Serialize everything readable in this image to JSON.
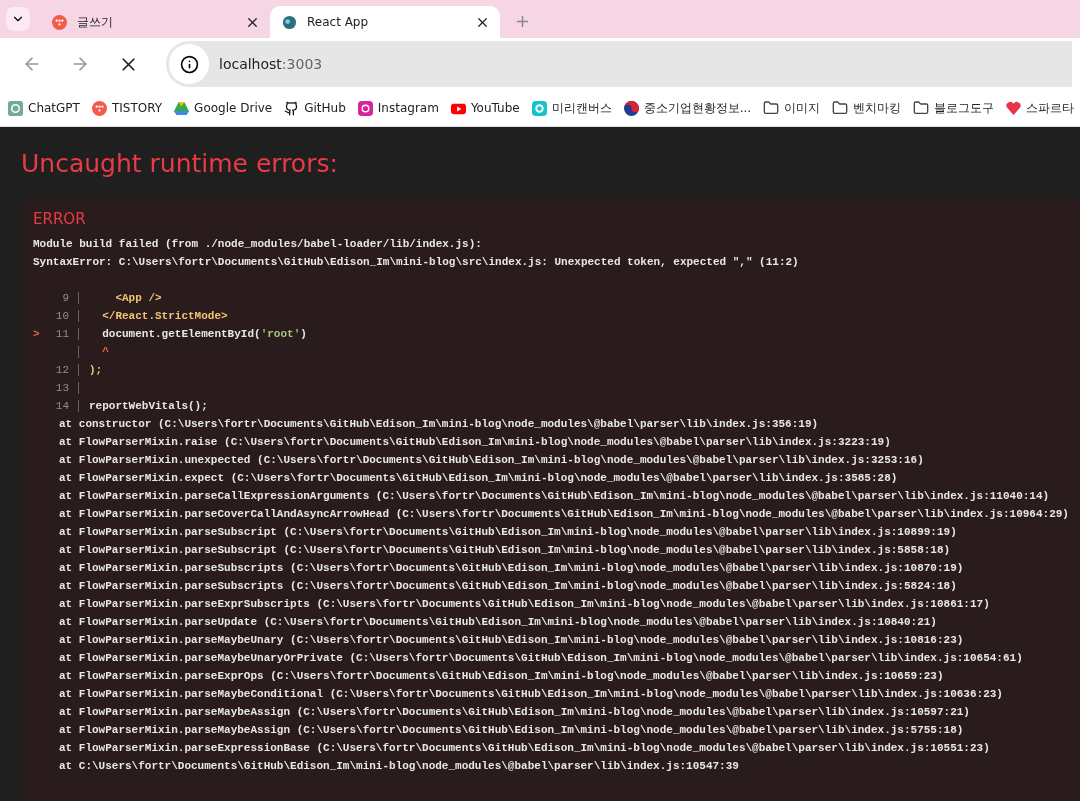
{
  "tabs": [
    {
      "title": "글쓰기",
      "selected": false
    },
    {
      "title": "React App",
      "selected": true
    }
  ],
  "address": {
    "host": "localhost",
    "port": ":3003"
  },
  "bookmarks": [
    {
      "label": "ChatGPT"
    },
    {
      "label": "TISTORY"
    },
    {
      "label": "Google Drive"
    },
    {
      "label": "GitHub"
    },
    {
      "label": "Instagram"
    },
    {
      "label": "YouTube"
    },
    {
      "label": "미리캔버스"
    },
    {
      "label": "중소기업현황정보..."
    },
    {
      "label": "이미지"
    },
    {
      "label": "벤치마킹"
    },
    {
      "label": "블로그도구"
    },
    {
      "label": "스파르타"
    }
  ],
  "overlay": {
    "heading": "Uncaught runtime errors:",
    "error_label": "ERROR",
    "message": [
      "Module build failed (from ./node_modules/babel-loader/lib/index.js):",
      "SyntaxError: C:\\Users\\fortr\\Documents\\GitHub\\Edison_Im\\mini-blog\\src\\index.js: Unexpected token, expected \",\" (11:2)"
    ],
    "code_frame": [
      {
        "number": "9",
        "tokens": [
          {
            "kind": "tag",
            "text": "    <App />"
          }
        ]
      },
      {
        "number": "10",
        "tokens": [
          {
            "kind": "tag",
            "text": "  </React.StrictMode>"
          }
        ]
      },
      {
        "number": "11",
        "marker": ">",
        "tokens": [
          {
            "kind": "plain",
            "text": "  document.getElementById("
          },
          {
            "kind": "string",
            "text": "'root'"
          },
          {
            "kind": "plain",
            "text": ")"
          }
        ]
      },
      {
        "tokens": [
          {
            "kind": "caret",
            "text": "  ^"
          }
        ]
      },
      {
        "number": "12",
        "tokens": [
          {
            "kind": "punct",
            "text": ");"
          }
        ]
      },
      {
        "number": "13"
      },
      {
        "number": "14",
        "tokens": [
          {
            "kind": "plain",
            "text": "reportWebVitals();"
          }
        ]
      }
    ],
    "stack": [
      "at constructor (C:\\Users\\fortr\\Documents\\GitHub\\Edison_Im\\mini-blog\\node_modules\\@babel\\parser\\lib\\index.js:356:19)",
      "at FlowParserMixin.raise (C:\\Users\\fortr\\Documents\\GitHub\\Edison_Im\\mini-blog\\node_modules\\@babel\\parser\\lib\\index.js:3223:19)",
      "at FlowParserMixin.unexpected (C:\\Users\\fortr\\Documents\\GitHub\\Edison_Im\\mini-blog\\node_modules\\@babel\\parser\\lib\\index.js:3253:16)",
      "at FlowParserMixin.expect (C:\\Users\\fortr\\Documents\\GitHub\\Edison_Im\\mini-blog\\node_modules\\@babel\\parser\\lib\\index.js:3585:28)",
      "at FlowParserMixin.parseCallExpressionArguments (C:\\Users\\fortr\\Documents\\GitHub\\Edison_Im\\mini-blog\\node_modules\\@babel\\parser\\lib\\index.js:11040:14)",
      "at FlowParserMixin.parseCoverCallAndAsyncArrowHead (C:\\Users\\fortr\\Documents\\GitHub\\Edison_Im\\mini-blog\\node_modules\\@babel\\parser\\lib\\index.js:10964:29)",
      "at FlowParserMixin.parseSubscript (C:\\Users\\fortr\\Documents\\GitHub\\Edison_Im\\mini-blog\\node_modules\\@babel\\parser\\lib\\index.js:10899:19)",
      "at FlowParserMixin.parseSubscript (C:\\Users\\fortr\\Documents\\GitHub\\Edison_Im\\mini-blog\\node_modules\\@babel\\parser\\lib\\index.js:5858:18)",
      "at FlowParserMixin.parseSubscripts (C:\\Users\\fortr\\Documents\\GitHub\\Edison_Im\\mini-blog\\node_modules\\@babel\\parser\\lib\\index.js:10870:19)",
      "at FlowParserMixin.parseSubscripts (C:\\Users\\fortr\\Documents\\GitHub\\Edison_Im\\mini-blog\\node_modules\\@babel\\parser\\lib\\index.js:5824:18)",
      "at FlowParserMixin.parseExprSubscripts (C:\\Users\\fortr\\Documents\\GitHub\\Edison_Im\\mini-blog\\node_modules\\@babel\\parser\\lib\\index.js:10861:17)",
      "at FlowParserMixin.parseUpdate (C:\\Users\\fortr\\Documents\\GitHub\\Edison_Im\\mini-blog\\node_modules\\@babel\\parser\\lib\\index.js:10840:21)",
      "at FlowParserMixin.parseMaybeUnary (C:\\Users\\fortr\\Documents\\GitHub\\Edison_Im\\mini-blog\\node_modules\\@babel\\parser\\lib\\index.js:10816:23)",
      "at FlowParserMixin.parseMaybeUnaryOrPrivate (C:\\Users\\fortr\\Documents\\GitHub\\Edison_Im\\mini-blog\\node_modules\\@babel\\parser\\lib\\index.js:10654:61)",
      "at FlowParserMixin.parseExprOps (C:\\Users\\fortr\\Documents\\GitHub\\Edison_Im\\mini-blog\\node_modules\\@babel\\parser\\lib\\index.js:10659:23)",
      "at FlowParserMixin.parseMaybeConditional (C:\\Users\\fortr\\Documents\\GitHub\\Edison_Im\\mini-blog\\node_modules\\@babel\\parser\\lib\\index.js:10636:23)",
      "at FlowParserMixin.parseMaybeAssign (C:\\Users\\fortr\\Documents\\GitHub\\Edison_Im\\mini-blog\\node_modules\\@babel\\parser\\lib\\index.js:10597:21)",
      "at FlowParserMixin.parseMaybeAssign (C:\\Users\\fortr\\Documents\\GitHub\\Edison_Im\\mini-blog\\node_modules\\@babel\\parser\\lib\\index.js:5755:18)",
      "at FlowParserMixin.parseExpressionBase (C:\\Users\\fortr\\Documents\\GitHub\\Edison_Im\\mini-blog\\node_modules\\@babel\\parser\\lib\\index.js:10551:23)",
      "at C:\\Users\\fortr\\Documents\\GitHub\\Edison_Im\\mini-blog\\node_modules\\@babel\\parser\\lib\\index.js:10547:39"
    ]
  }
}
